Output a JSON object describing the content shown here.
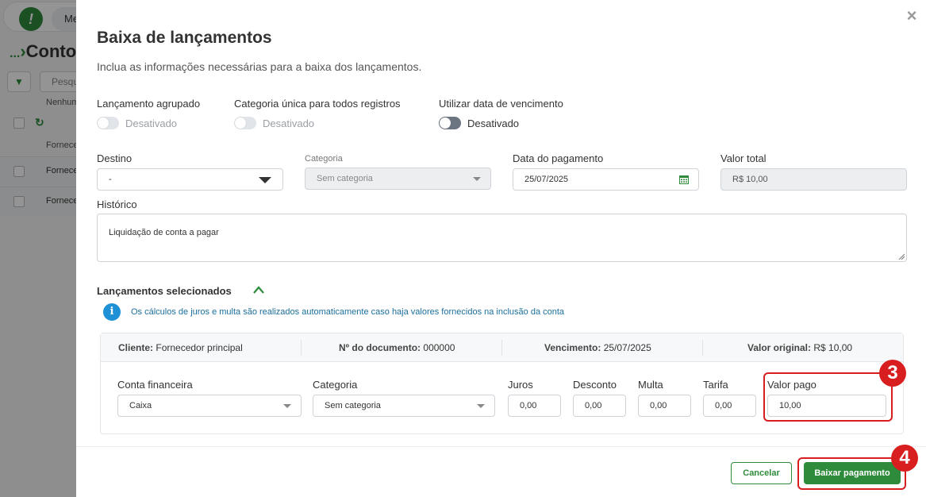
{
  "background": {
    "menu_label": "Meu",
    "crumb_dots": "...",
    "crumb_title": "Conto",
    "search_placeholder": "Pesqu",
    "none_label": "Nenhum",
    "column_label": "Fornece",
    "rows": [
      "Fornece",
      "Fornece"
    ]
  },
  "modal": {
    "title": "Baixa de lançamentos",
    "subtitle": "Inclua as informações necessárias para a baixa dos lançamentos.",
    "close_symbol": "×",
    "toggles": [
      {
        "label": "Lançamento agrupado",
        "state": "Desativado"
      },
      {
        "label": "Categoria única para todos registros",
        "state": "Desativado"
      },
      {
        "label": "Utilizar data de vencimento",
        "state": "Desativado"
      }
    ],
    "fields": {
      "destino": {
        "label": "Destino",
        "value": "-"
      },
      "categoria": {
        "label": "Categoria",
        "value": "Sem categoria"
      },
      "data_pagamento": {
        "label": "Data do pagamento",
        "value": "25/07/2025"
      },
      "valor_total": {
        "label": "Valor total",
        "value": "R$ 10,00"
      },
      "historico": {
        "label": "Histórico",
        "value": "Liquidação de conta a pagar"
      }
    },
    "section": {
      "title": "Lançamentos selecionados",
      "info": "Os cálculos de juros e multa são realizados automaticamente caso haja valores fornecidos na inclusão da conta",
      "info_icon": "i"
    },
    "entry": {
      "cliente_label": "Cliente:",
      "cliente_value": "Fornecedor principal",
      "documento_label": "Nº do documento:",
      "documento_value": "000000",
      "vencimento_label": "Vencimento:",
      "vencimento_value": "25/07/2025",
      "valor_original_label": "Valor original:",
      "valor_original_value": "R$ 10,00",
      "conta_label": "Conta financeira",
      "conta_value": "Caixa",
      "categoria_label": "Categoria",
      "categoria_value": "Sem categoria",
      "juros_label": "Juros",
      "juros_value": "0,00",
      "desconto_label": "Desconto",
      "desconto_value": "0,00",
      "multa_label": "Multa",
      "multa_value": "0,00",
      "tarifa_label": "Tarifa",
      "tarifa_value": "0,00",
      "valor_pago_label": "Valor pago",
      "valor_pago_value": "10,00"
    },
    "buttons": {
      "cancel": "Cancelar",
      "pay": "Baixar pagamento"
    },
    "badges": {
      "step3": "3",
      "step4": "4"
    }
  },
  "colors": {
    "brand_green": "#2e8b3c",
    "highlight_red": "#d81e1e",
    "info_blue": "#1e90d6"
  }
}
